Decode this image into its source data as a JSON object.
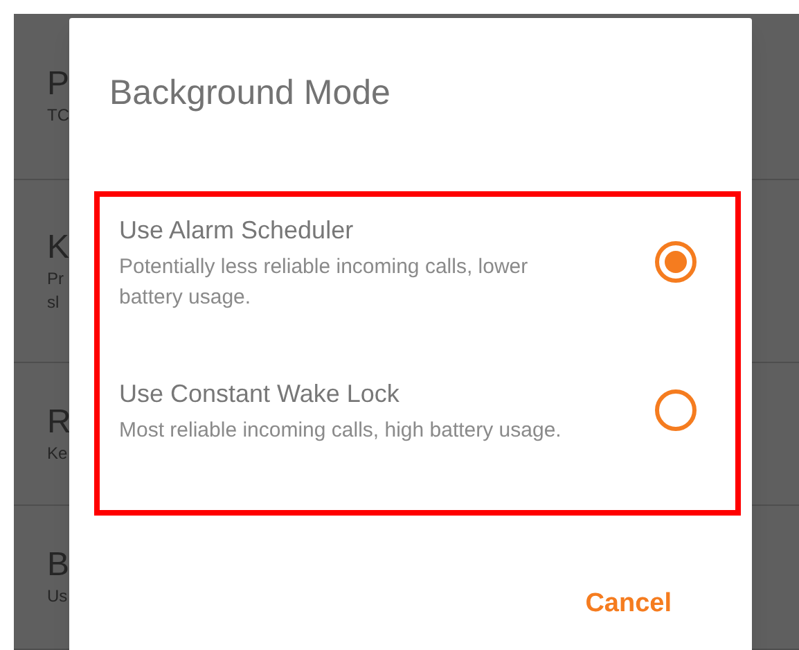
{
  "background_list": [
    {
      "title": "P",
      "subtitle": [
        "TC"
      ]
    },
    {
      "title": "K",
      "subtitle": [
        "Pr",
        "sl"
      ]
    },
    {
      "title": "R",
      "subtitle": [
        "Ke"
      ]
    },
    {
      "title": "B",
      "subtitle": [
        "Us"
      ]
    }
  ],
  "dialog": {
    "title": "Background Mode",
    "options": [
      {
        "label": "Use Alarm Scheduler",
        "description": "Potentially less reliable incoming calls, lower battery usage.",
        "selected": true
      },
      {
        "label": "Use Constant Wake Lock",
        "description": "Most reliable incoming calls, high battery usage.",
        "selected": false
      }
    ],
    "buttons": [
      "Cancel"
    ]
  }
}
